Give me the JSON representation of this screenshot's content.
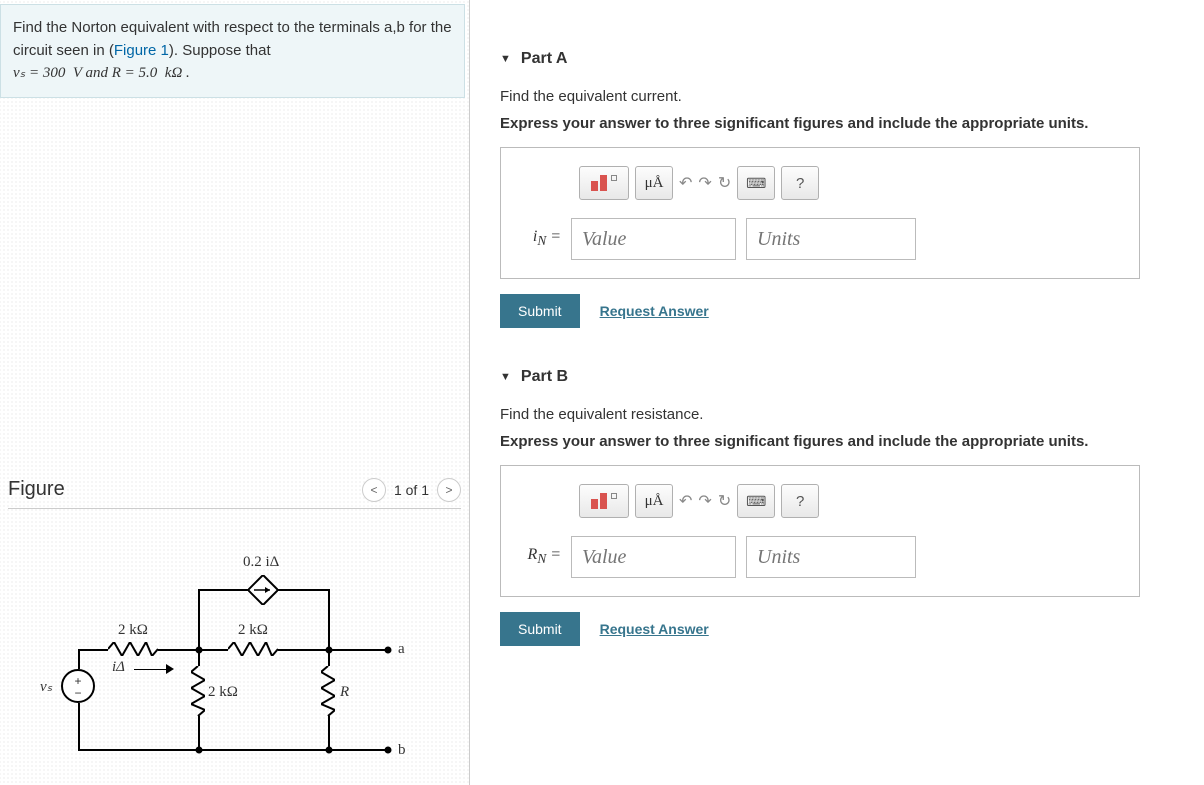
{
  "problem": {
    "text_parts": {
      "line1a": "Find the Norton equivalent with respect to the terminals a,b for the circuit seen in (",
      "figure_link": "Figure 1",
      "line1b": "). Suppose that",
      "line2": "vₛ = 300  V and R = 5.0  kΩ ."
    }
  },
  "figure": {
    "title": "Figure",
    "nav_label": "1 of 1",
    "circuit_labels": {
      "dep_src": "0.2 iΔ",
      "r1": "2 kΩ",
      "r2": "2 kΩ",
      "r3": "2 kΩ",
      "r4": "R",
      "vs": "vₛ",
      "ia": "iΔ",
      "term_a": "a",
      "term_b": "b"
    }
  },
  "parts": {
    "A": {
      "header": "Part A",
      "instruction": "Find the equivalent current.",
      "bold_instruction": "Express your answer to three significant figures and include the appropriate units.",
      "symbol": "iₙ =",
      "value_placeholder": "Value",
      "units_placeholder": "Units"
    },
    "B": {
      "header": "Part B",
      "instruction": "Find the equivalent resistance.",
      "bold_instruction": "Express your answer to three significant figures and include the appropriate units.",
      "symbol": "Rₙ =",
      "value_placeholder": "Value",
      "units_placeholder": "Units"
    }
  },
  "toolbar": {
    "units_icon": "μÅ",
    "undo": "↶",
    "redo": "↷",
    "reset": "↻",
    "keyboard": "⌨",
    "help": "?"
  },
  "actions": {
    "submit": "Submit",
    "request": "Request Answer"
  }
}
